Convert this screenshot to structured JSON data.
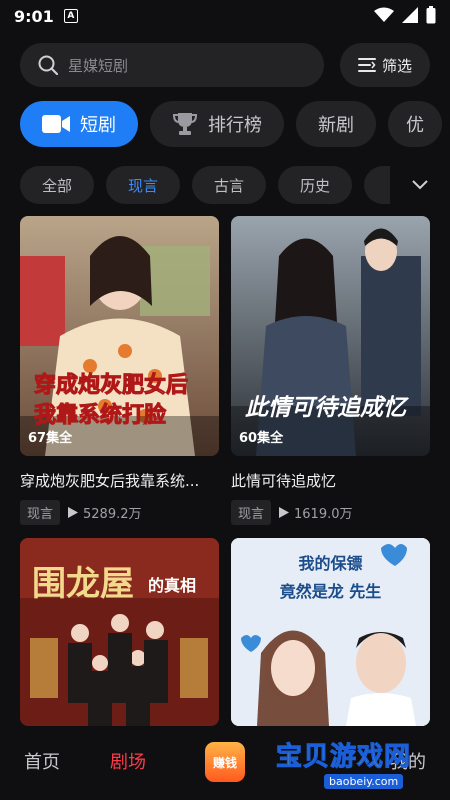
{
  "status": {
    "time": "9:01",
    "notif_badge": "A"
  },
  "search": {
    "placeholder": "星媒短剧",
    "filter_label": "筛选"
  },
  "main_tabs": [
    {
      "label": "短剧",
      "active": true
    },
    {
      "label": "排行榜",
      "active": false
    },
    {
      "label": "新剧",
      "active": false
    },
    {
      "label": "优",
      "active": false
    }
  ],
  "sub_tabs": [
    {
      "label": "全部",
      "active": false
    },
    {
      "label": "现言",
      "active": true
    },
    {
      "label": "古言",
      "active": false
    },
    {
      "label": "历史",
      "active": false
    }
  ],
  "cards": [
    {
      "poster_title": "穿成炮灰肥女后\n我靠系统打脸",
      "episodes": "67集全",
      "title": "穿成炮灰肥女后我靠系统...",
      "genre": "现言",
      "plays": "5289.2万"
    },
    {
      "poster_title": "此情可待追成忆",
      "episodes": "60集全",
      "title": "此情可待追成忆",
      "genre": "现言",
      "plays": "1619.0万"
    },
    {
      "poster_title": "围龙屋",
      "poster_subtitle": "的真相"
    },
    {
      "poster_title": "我的保镖",
      "poster_subtitle": "竟然是龙 先生"
    }
  ],
  "bottom_nav": {
    "home": "首页",
    "theater": "剧场",
    "earn": "赚钱",
    "mine": "我的"
  },
  "watermark": {
    "text": "宝贝游戏网",
    "url": "baobeiy.com"
  },
  "colors": {
    "accent": "#1f7df5",
    "nav_active": "#ff3b4a",
    "background": "#0f0f11"
  }
}
